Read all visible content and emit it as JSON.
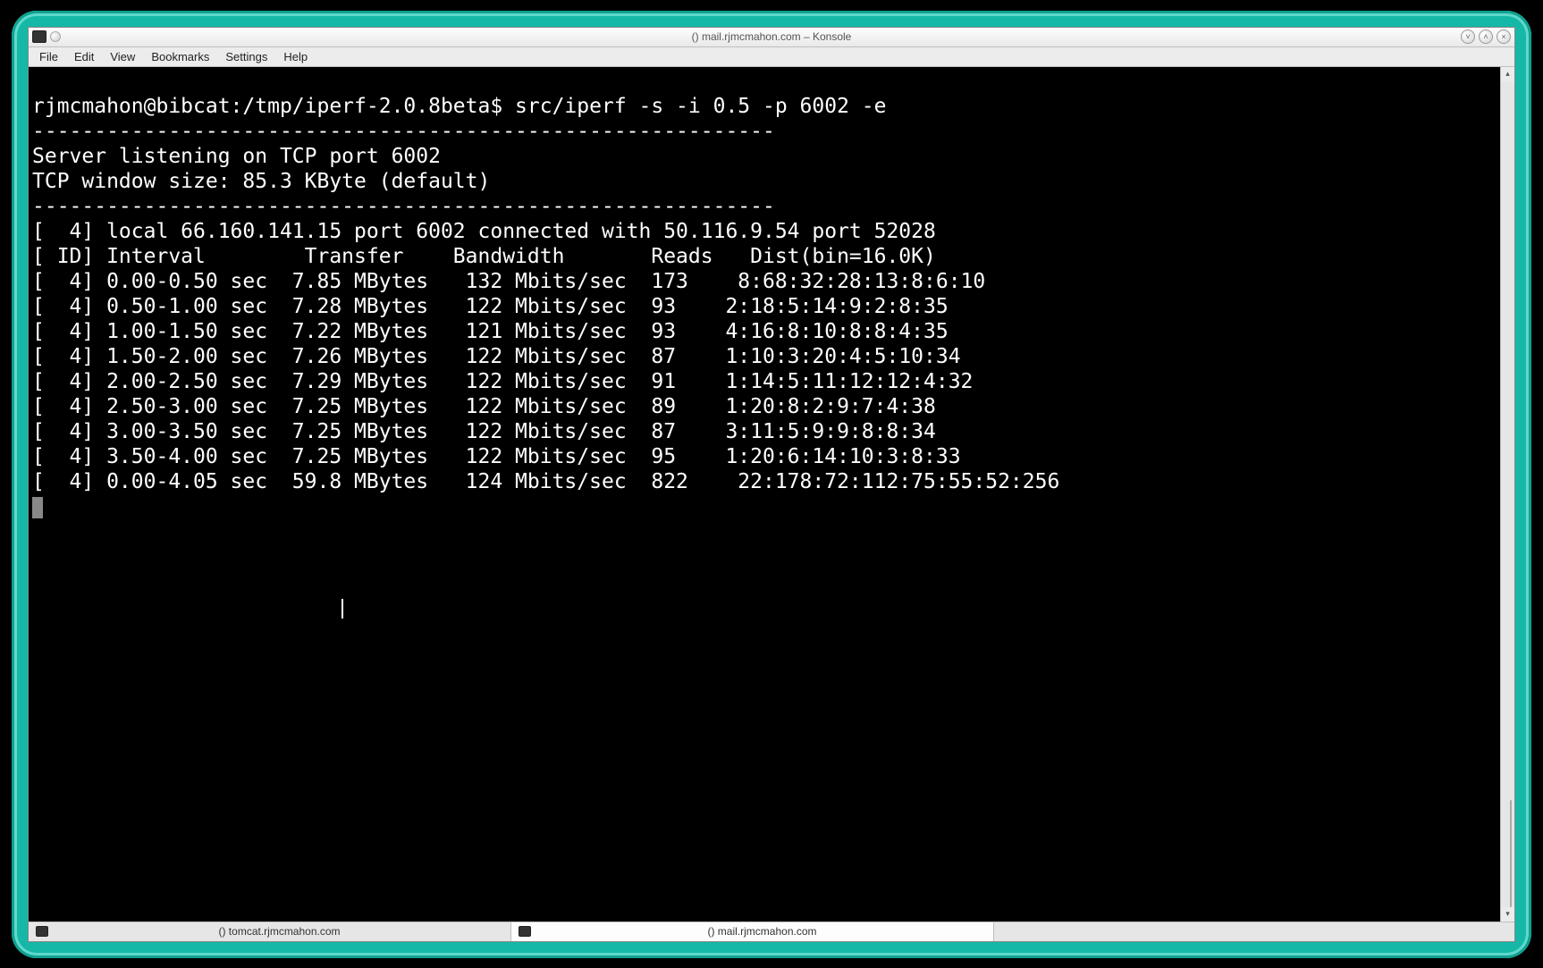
{
  "window": {
    "title": "() mail.rjmcmahon.com – Konsole"
  },
  "menus": {
    "file": "File",
    "edit": "Edit",
    "view": "View",
    "bookmarks": "Bookmarks",
    "settings": "Settings",
    "help": "Help"
  },
  "tabs": {
    "tab1": "() tomcat.rjmcmahon.com",
    "tab2": "() mail.rjmcmahon.com"
  },
  "prompt": {
    "user_host_path": "rjmcmahon@bibcat:/tmp/iperf-2.0.8beta$ ",
    "command": "src/iperf -s -i 0.5 -p 6002 -e"
  },
  "output": {
    "sep": "------------------------------------------------------------",
    "listen": "Server listening on TCP port 6002",
    "winsize": "TCP window size: 85.3 KByte (default)",
    "connline": "[  4] local 66.160.141.15 port 6002 connected with 50.116.9.54 port 52028",
    "header": "[ ID] Interval        Transfer    Bandwidth       Reads   Dist(bin=16.0K)",
    "rows": [
      "[  4] 0.00-0.50 sec  7.85 MBytes   132 Mbits/sec  173    8:68:32:28:13:8:6:10",
      "[  4] 0.50-1.00 sec  7.28 MBytes   122 Mbits/sec  93    2:18:5:14:9:2:8:35",
      "[  4] 1.00-1.50 sec  7.22 MBytes   121 Mbits/sec  93    4:16:8:10:8:8:4:35",
      "[  4] 1.50-2.00 sec  7.26 MBytes   122 Mbits/sec  87    1:10:3:20:4:5:10:34",
      "[  4] 2.00-2.50 sec  7.29 MBytes   122 Mbits/sec  91    1:14:5:11:12:12:4:32",
      "[  4] 2.50-3.00 sec  7.25 MBytes   122 Mbits/sec  89    1:20:8:2:9:7:4:38",
      "[  4] 3.00-3.50 sec  7.25 MBytes   122 Mbits/sec  87    3:11:5:9:9:8:8:34",
      "[  4] 3.50-4.00 sec  7.25 MBytes   122 Mbits/sec  95    1:20:6:14:10:3:8:33",
      "[  4] 0.00-4.05 sec  59.8 MBytes   124 Mbits/sec  822    22:178:72:112:75:55:52:256"
    ]
  }
}
